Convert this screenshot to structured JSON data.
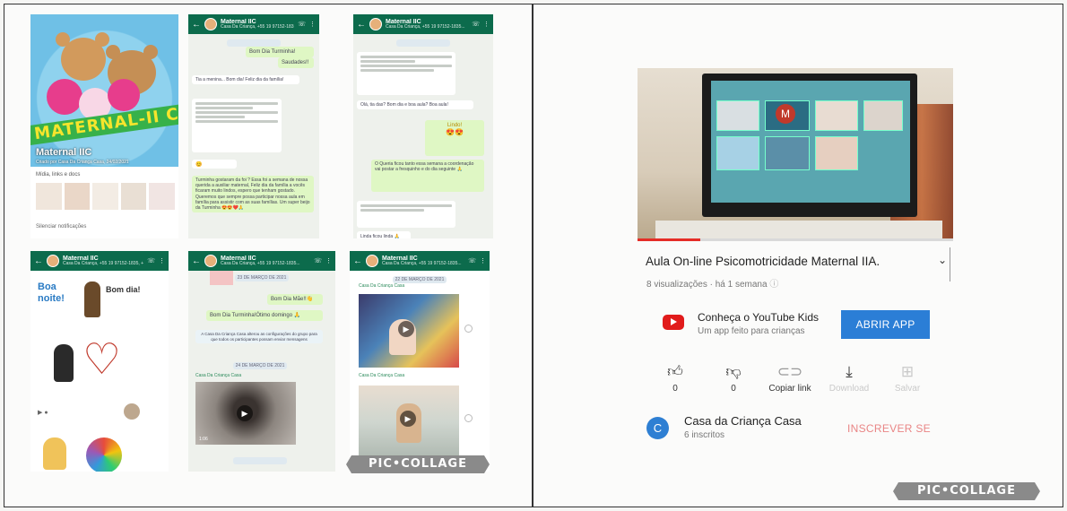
{
  "collage_label": "PIC•COLLAGE",
  "whatsapp": {
    "group_name": "Maternal IIC",
    "group_info": {
      "title": "Maternal IIC",
      "created_by": "Criado por Casa Da Criança Casa, 24/02/2021",
      "banner_text": "MATERNAL-II C",
      "media_label": "Mídia, links e docs",
      "notifications_label": "Silenciar notificações"
    },
    "header_sub_a": "Casa Da Criança, +55 19 97152-1835...",
    "header_sub_b": "Casa Da Criança, +55 19 97152-1835, +55...",
    "chat_a": {
      "out_1": "Bom Dia Turminha!",
      "out_2": "Saudades!!",
      "in_1": "Tia a menina... Bom dia! Feliz dia da família!",
      "in_2": "Turminha gostaram da foi ? Essa foi a semana de nossa querida a auxiliar maternal, Feliz dia da família a vocês ficaram muito lindos, espero que tenham gostado. Queremos que sempre possa participar nossa aula em família para assistir com as suas famílias. Um super beijo da Turminha 😍😍❤️🙏",
      "emoji_in": "😊"
    },
    "chat_c": {
      "in_1": "Olá, tia das? Bom dia e boa aula? Boa aula!",
      "out_1": "Lindo!",
      "out_emoji": "😍😍",
      "out_2": "O Queria ficou tanto essa semana a coordenação vai postar a fresquinho e do dia seguinte 🙏",
      "in_2": "Linda ficou linda 🙏"
    },
    "chat_d": {
      "sticker_1": "Boa noite!",
      "sticker_2": "Bom dia!"
    },
    "chat_e": {
      "date_1": "23 DE MARÇO DE 2021",
      "out_1": "Bom Dia Mãe!!👋",
      "out_2": "Bom Dia Turminha!Ótimo domingo 🙏",
      "system": "A Casa Da Criança Casa alterou as configurações do grupo para que todos os participantes possam enviar mensagens",
      "date_2": "24 DE MARÇO DE 2021",
      "sender": "Casa Da Criança Casa",
      "video_len": "1:06"
    },
    "chat_f": {
      "date_1": "22 DE MARÇO DE 2021",
      "sender_1": "Casa Da Criança Casa",
      "sender_2": "Casa Da Criança Casa"
    }
  },
  "youtube": {
    "title": "Aula On-line Psicomotricidade Maternal IIA.",
    "meta": "8 visualizações · há 1 semana",
    "kids_title": "Conheça o YouTube Kids",
    "kids_sub": "Um app feito para crianças",
    "open_button": "ABRIR APP",
    "actions": [
      {
        "icon": "thumbs-up-icon",
        "label": "0"
      },
      {
        "icon": "thumbs-down-icon",
        "label": "0"
      },
      {
        "icon": "link-icon",
        "label": "Copiar link"
      },
      {
        "icon": "download-icon",
        "label": "Download"
      },
      {
        "icon": "save-icon",
        "label": "Salvar"
      }
    ],
    "channel_initial": "C",
    "channel_name": "Casa da Criança Casa",
    "subscribers": "6 inscritos",
    "subscribe_label": "INSCREVER SE",
    "progress": 0.2,
    "colors": {
      "accent": "#2b7ed6",
      "subscribe": "#e98585",
      "kids_red": "#e11b1b"
    }
  }
}
